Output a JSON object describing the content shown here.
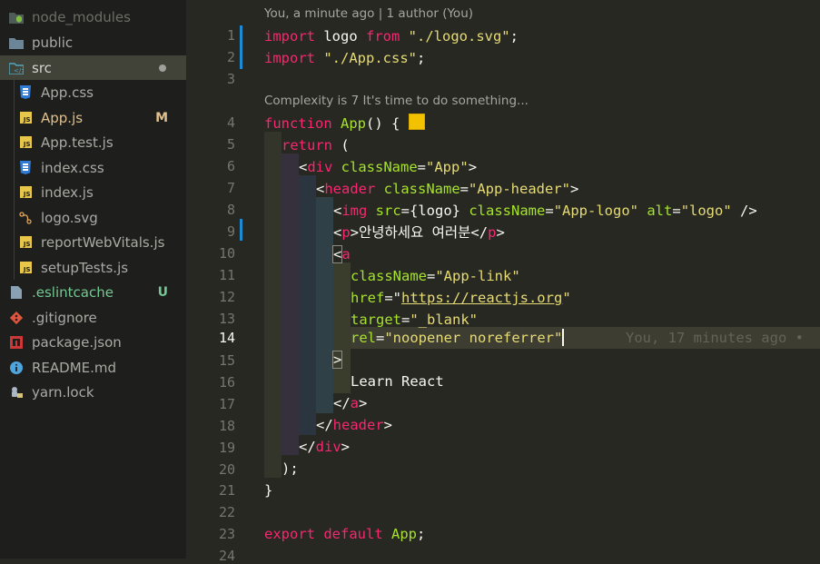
{
  "sidebar": {
    "items": [
      {
        "label": "node_modules",
        "icon": "node-folder-icon",
        "badge": "",
        "color": "#6c6d67"
      },
      {
        "label": "public",
        "icon": "folder-icon",
        "badge": "",
        "color": "#a9aaa4"
      },
      {
        "label": "src",
        "icon": "src-folder-icon",
        "badge": "",
        "color": "#a9aaa4"
      },
      {
        "label": "App.css",
        "icon": "css-file-icon",
        "badge": "",
        "color": "#a9aaa4"
      },
      {
        "label": "App.js",
        "icon": "js-file-icon",
        "badge": "M",
        "color": "#e2c08d"
      },
      {
        "label": "App.test.js",
        "icon": "js-file-icon",
        "badge": "",
        "color": "#a9aaa4"
      },
      {
        "label": "index.css",
        "icon": "css-file-icon",
        "badge": "",
        "color": "#a9aaa4"
      },
      {
        "label": "index.js",
        "icon": "js-file-icon",
        "badge": "",
        "color": "#a9aaa4"
      },
      {
        "label": "logo.svg",
        "icon": "svg-file-icon",
        "badge": "",
        "color": "#a9aaa4"
      },
      {
        "label": "reportWebVitals.js",
        "icon": "js-file-icon",
        "badge": "",
        "color": "#a9aaa4"
      },
      {
        "label": "setupTests.js",
        "icon": "js-file-icon",
        "badge": "",
        "color": "#a9aaa4"
      },
      {
        "label": ".eslintcache",
        "icon": "file-icon",
        "badge": "U",
        "color": "#73c991"
      },
      {
        "label": ".gitignore",
        "icon": "git-icon",
        "badge": "",
        "color": "#a9aaa4"
      },
      {
        "label": "package.json",
        "icon": "npm-icon",
        "badge": "",
        "color": "#a9aaa4"
      },
      {
        "label": "README.md",
        "icon": "info-icon",
        "badge": "",
        "color": "#a9aaa4"
      },
      {
        "label": "yarn.lock",
        "icon": "yarn-icon",
        "badge": "",
        "color": "#a9aaa4"
      }
    ],
    "selected_badge_color": "#e2c08d",
    "untracked_badge_color": "#73c991"
  },
  "editor": {
    "blame_top": "You, a minute ago | 1 author (You)",
    "complexity_lens": "Complexity is 7 It's time to do something...",
    "current_line": 14,
    "inline_blame": "You, 17 minutes ago •",
    "line_numbers": [
      "1",
      "2",
      "3",
      "4",
      "5",
      "6",
      "7",
      "8",
      "9",
      "10",
      "11",
      "12",
      "13",
      "14",
      "15",
      "16",
      "17",
      "18",
      "19",
      "20",
      "21",
      "22",
      "23",
      "24"
    ],
    "code": {
      "l1": {
        "a": "import",
        "b": " logo ",
        "c": "from",
        "d": " \"./logo.svg\"",
        "e": ";"
      },
      "l2": {
        "a": "import",
        "b": " \"./App.css\"",
        "c": ";"
      },
      "l4": {
        "a": "function",
        "b": " ",
        "c": "App",
        "d": "() {"
      },
      "l5": {
        "a": "return",
        "b": " ("
      },
      "l6": {
        "a": "<",
        "b": "div",
        "c": " className",
        "d": "=",
        "e": "\"App\"",
        "f": ">"
      },
      "l7": {
        "a": "<",
        "b": "header",
        "c": " className",
        "d": "=",
        "e": "\"App-header\"",
        "f": ">"
      },
      "l8": {
        "a": "<",
        "b": "img",
        "c": " src",
        "d": "={",
        "e": "logo",
        "f": "} ",
        "g": "className",
        "h": "=",
        "i": "\"App-logo\"",
        "j": " alt",
        "k": "=",
        "l": "\"logo\"",
        "m": " />"
      },
      "l9": {
        "a": "<",
        "b": "p",
        "c": ">안녕하세요 여러분</",
        "d": "p",
        "e": ">"
      },
      "l10": {
        "a": "<",
        "b": "a"
      },
      "l11": {
        "a": "className",
        "b": "=",
        "c": "\"App-link\""
      },
      "l12": {
        "a": "href",
        "b": "=\"",
        "c": "https://reactjs.org",
        "d": "\""
      },
      "l13": {
        "a": "target",
        "b": "=",
        "c": "\"_blank\""
      },
      "l14": {
        "a": "rel",
        "b": "=",
        "c": "\"noopener noreferrer\""
      },
      "l15": {
        "a": ">"
      },
      "l16": {
        "a": "Learn React"
      },
      "l17": {
        "a": "</",
        "b": "a",
        "c": ">"
      },
      "l18": {
        "a": "</",
        "b": "header",
        "c": ">"
      },
      "l19": {
        "a": "</",
        "b": "div",
        "c": ">"
      },
      "l20": {
        "a": ");"
      },
      "l21": {
        "a": "}"
      },
      "l23": {
        "a": "export",
        "b": " ",
        "c": "default",
        "d": " ",
        "e": "App",
        "f": ";"
      }
    }
  },
  "colors": {
    "keyword": "#f92672",
    "function": "#a6e22e",
    "string": "#e6db74",
    "sidebar_bg": "#1e1f1c",
    "editor_bg": "#272822",
    "modified": "#1f8ad3"
  }
}
